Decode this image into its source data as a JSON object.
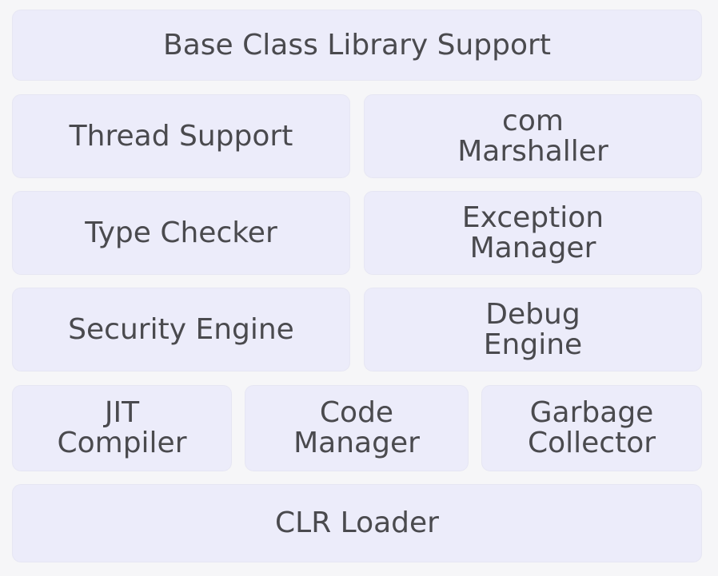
{
  "layers": {
    "base_class_library": "Base Class Library Support",
    "thread_support": "Thread Support",
    "com_marshaller": "com\nMarshaller",
    "type_checker": "Type Checker",
    "exception_manager": "Exception\nManager",
    "security_engine": "Security Engine",
    "debug_engine": "Debug\nEngine",
    "jit_compiler": "JIT\nCompiler",
    "code_manager": "Code\nManager",
    "garbage_collector": "Garbage\nCollector",
    "clr_loader": "CLR Loader"
  },
  "colors": {
    "box_fill": "#ececfa",
    "text": "#4a4a4e",
    "background": "#f6f6f8"
  }
}
